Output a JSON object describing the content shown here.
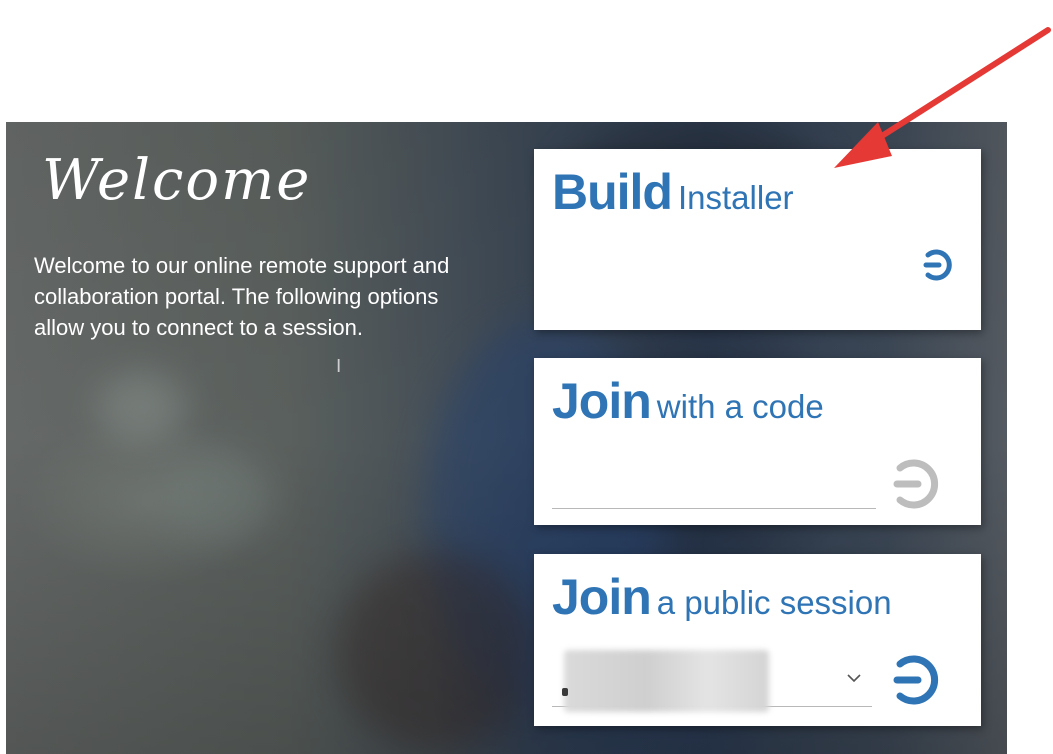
{
  "welcome": {
    "title": "Welcome",
    "text": "Welcome to our online remote support and collaboration portal. The following options allow you to connect to a session."
  },
  "cards": {
    "build": {
      "big": "Build",
      "small": "Installer"
    },
    "code": {
      "big": "Join",
      "small": "with a code",
      "input_value": ""
    },
    "public": {
      "big": "Join",
      "small": "a public session",
      "selected_value": ""
    }
  },
  "colors": {
    "accent": "#2f74b5",
    "arrow": "#e53935",
    "disabled": "#bdbdbd"
  },
  "icons": {
    "go": "arrow-right-circle-icon",
    "dropdown": "chevron-down-icon",
    "annotation": "red-arrow-icon"
  }
}
